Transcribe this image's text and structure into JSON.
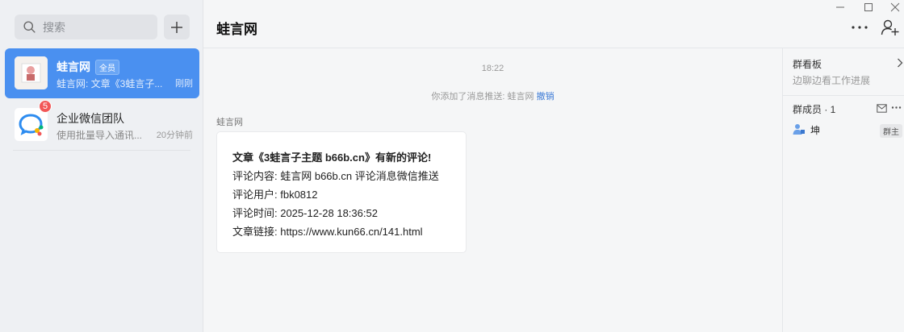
{
  "search": {
    "placeholder": "搜索"
  },
  "chats": [
    {
      "name": "蛙言网",
      "tag": "全员",
      "preview": "蛙言网: 文章《3蛙言子...",
      "time": "刚刚",
      "active": true
    },
    {
      "name": "企业微信团队",
      "preview": "使用批量导入通讯...",
      "time": "20分钟前",
      "badge": "5"
    }
  ],
  "conversation": {
    "title": "蛙言网",
    "time": "18:22",
    "system_message": "你添加了消息推送: 蛙言网",
    "undo_link": "撤销",
    "sender": "蛙言网",
    "card": {
      "title": "文章《3蛙言子主题 b66b.cn》有新的评论!",
      "line1": "评论内容: 蛙言网 b66b.cn  评论消息微信推送",
      "line2": "评论用户: fbk0812",
      "line3": "评论时间: 2025-12-28 18:36:52",
      "line4": "文章链接: https://www.kun66.cn/141.html"
    }
  },
  "right_panel": {
    "board_title": "群看板",
    "board_subtitle": "边聊边看工作进展",
    "members_title": "群成员 · 1",
    "member_name": "坤",
    "owner_tag": "群主"
  },
  "colors": {
    "accent": "#4a90f0",
    "badge": "#f25757",
    "link": "#3d7bd6"
  }
}
